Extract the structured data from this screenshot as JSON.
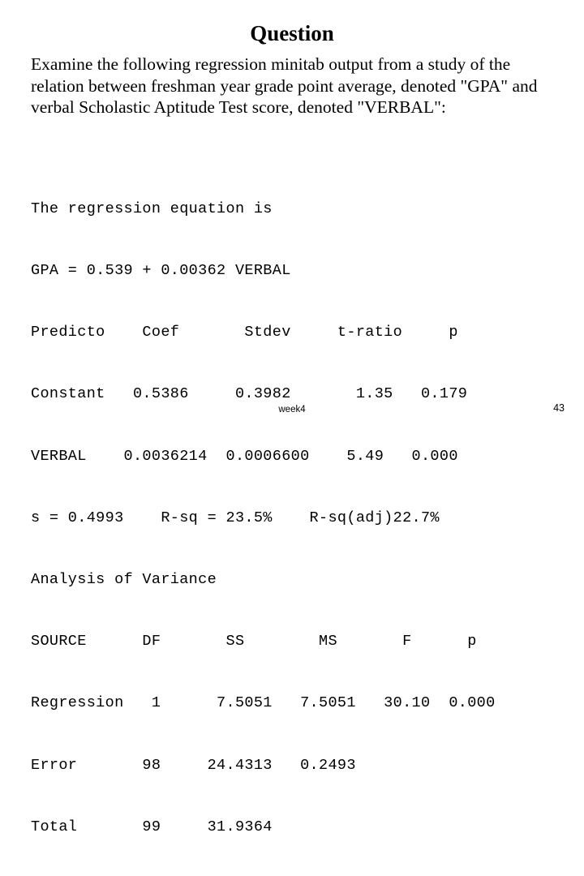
{
  "slide": {
    "title": "Question",
    "body_paragraph": "Examine the following regression minitab output from a study of the relation between freshman year grade point average, denoted \"GPA\" and verbal Scholastic Aptitude Test score, denoted \"VERBAL\":",
    "footer_label": "week4",
    "page_number": "43"
  },
  "minitab_output": {
    "lines": [
      "The regression equation is",
      "GPA = 0.539 + 0.00362 VERBAL",
      "Predicto    Coef       Stdev     t-ratio     p",
      "Constant   0.5386     0.3982       1.35   0.179",
      "VERBAL    0.0036214  0.0006600    5.49   0.000",
      "s = 0.4993    R-sq = 23.5%    R-sq(adj)22.7%",
      "Analysis of Variance",
      "SOURCE      DF       SS        MS       F      p",
      "Regression   1      7.5051   7.5051   30.10  0.000",
      "Error       98     24.4313   0.2493",
      "Total       99     31.9364"
    ],
    "regression_equation": {
      "response": "GPA",
      "intercept": "0.539",
      "slope": "0.00362",
      "predictor": "VERBAL"
    },
    "coefficient_table": {
      "headers": [
        "Predicto",
        "Coef",
        "Stdev",
        "t-ratio",
        "p"
      ],
      "rows": [
        [
          "Constant",
          "0.5386",
          "0.3982",
          "1.35",
          "0.179"
        ],
        [
          "VERBAL",
          "0.0036214",
          "0.0006600",
          "5.49",
          "0.000"
        ]
      ]
    },
    "model_summary": {
      "s": "0.4993",
      "r_sq": "23.5%",
      "r_sq_adj": "22.7%"
    },
    "anova": {
      "title": "Analysis of Variance",
      "headers": [
        "SOURCE",
        "DF",
        "SS",
        "MS",
        "F",
        "p"
      ],
      "rows": [
        [
          "Regression",
          "1",
          "7.5051",
          "7.5051",
          "30.10",
          "0.000"
        ],
        [
          "Error",
          "98",
          "24.4313",
          "0.2493",
          "",
          ""
        ],
        [
          "Total",
          "99",
          "31.9364",
          "",
          "",
          ""
        ]
      ]
    }
  }
}
